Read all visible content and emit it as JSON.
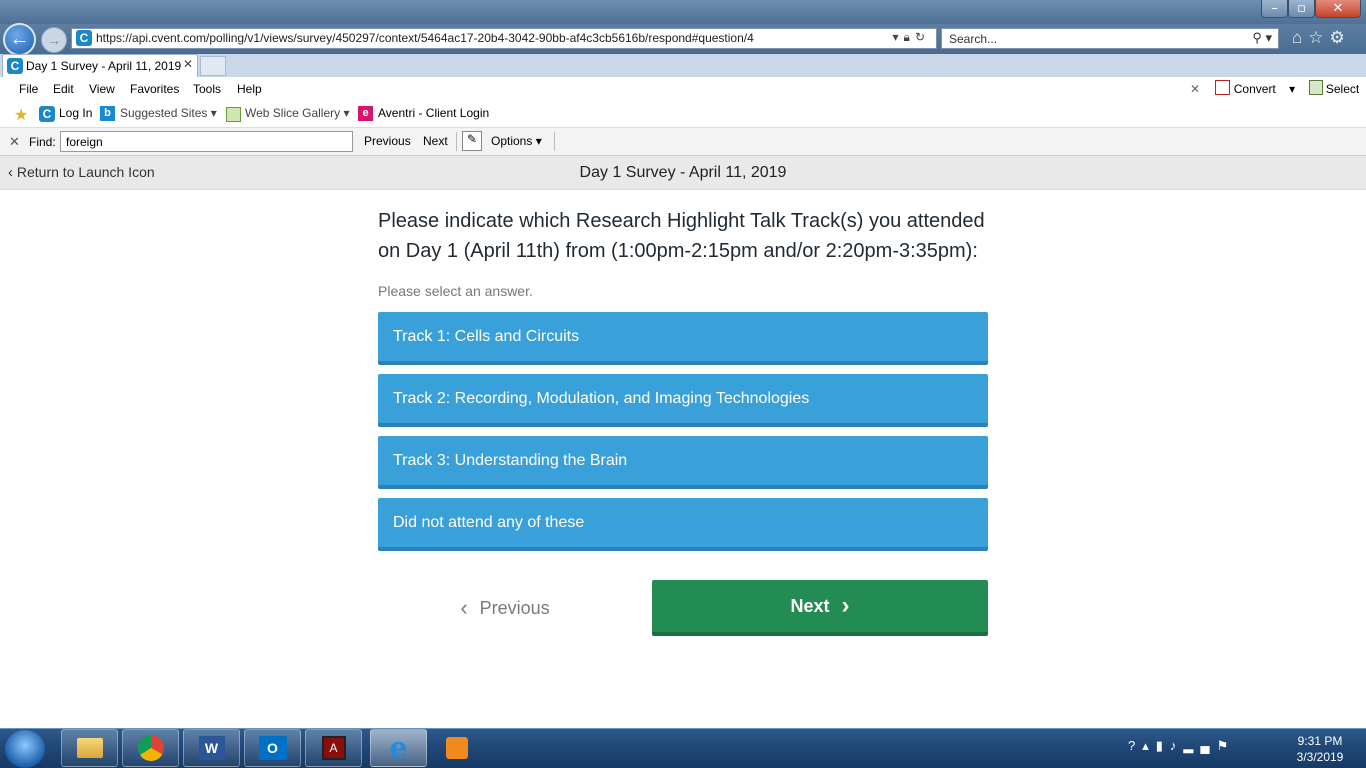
{
  "browser": {
    "url": "https://api.cvent.com/polling/v1/views/survey/450297/context/5464ac17-20b4-3042-90bb-af4c3cb5616b/respond#question/4",
    "search_placeholder": "Search...",
    "tab_title": "Day 1 Survey - April 11, 2019",
    "menu": [
      "File",
      "Edit",
      "View",
      "Favorites",
      "Tools",
      "Help"
    ],
    "convert_label": "Convert",
    "select_label": "Select",
    "favorites": {
      "login": "Log In",
      "suggested": "Suggested Sites",
      "webslice": "Web Slice Gallery",
      "aventri": "Aventri - Client Login"
    },
    "find": {
      "label": "Find:",
      "value": "foreign",
      "previous": "Previous",
      "next": "Next",
      "options": "Options"
    }
  },
  "survey": {
    "return_label": "Return to Launch Icon",
    "title": "Day 1 Survey - April 11, 2019",
    "question": "Please indicate which Research Highlight Talk Track(s) you attended on Day 1 (April 11th) from (1:00pm-2:15pm and/or 2:20pm-3:35pm):",
    "hint": "Please select an answer.",
    "answers": [
      "Track 1: Cells and Circuits",
      "Track 2: Recording, Modulation, and Imaging Technologies",
      "Track 3: Understanding the Brain",
      "Did not attend any of these"
    ],
    "previous_label": "Previous",
    "next_label": "Next"
  },
  "taskbar": {
    "time": "9:31 PM",
    "date": "3/3/2019",
    "apps": [
      "file-explorer-icon",
      "chrome-icon",
      "word-icon",
      "outlook-icon",
      "acrobat-icon",
      "internet-explorer-icon",
      "media-player-icon"
    ]
  },
  "colors": {
    "answer_blue": "#3aa0da",
    "next_green": "#238c52",
    "cvent_blue": "#1b88c8"
  }
}
